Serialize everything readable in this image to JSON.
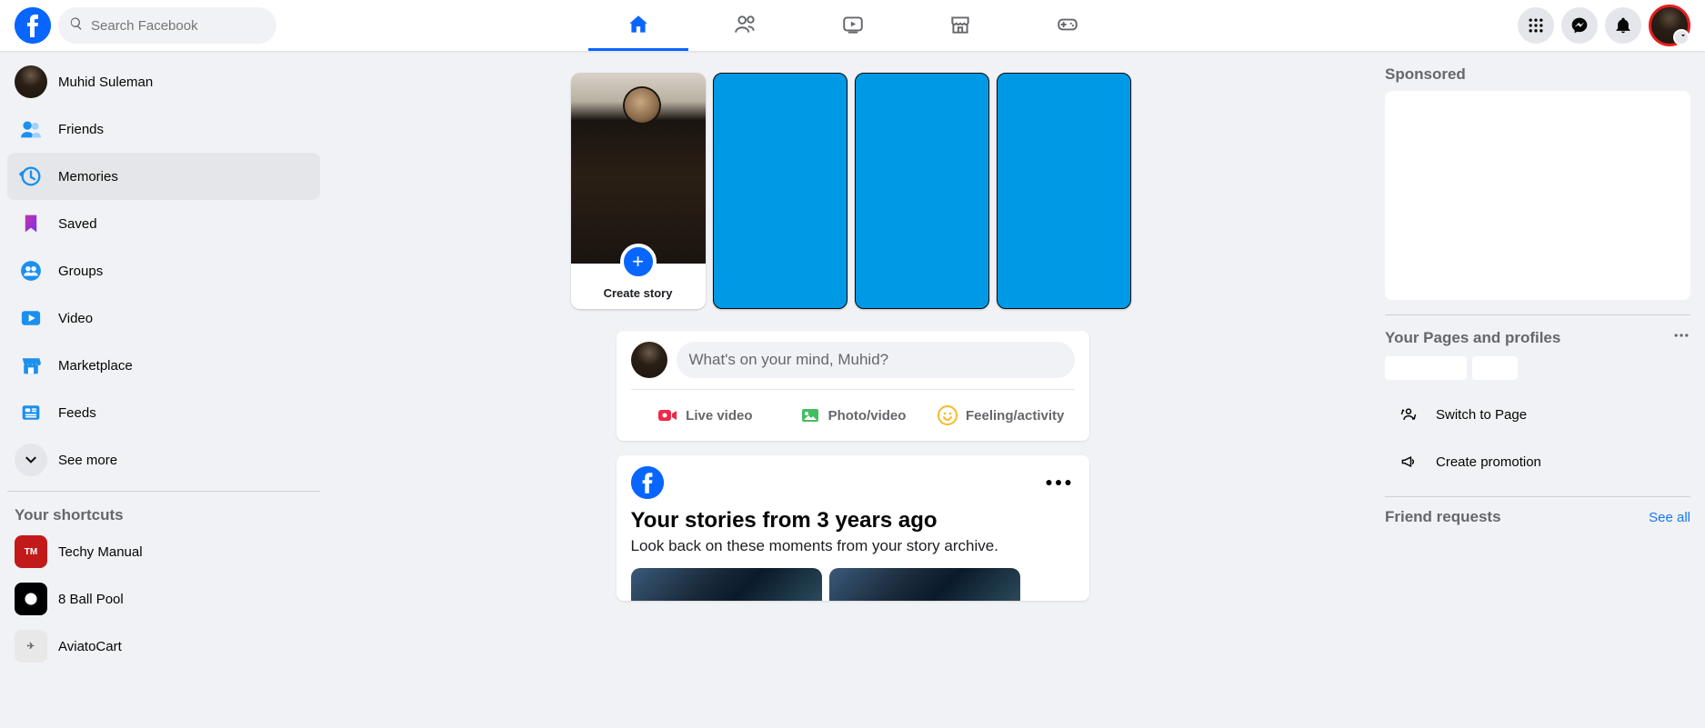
{
  "header": {
    "search_placeholder": "Search Facebook"
  },
  "sidebar": {
    "items": [
      {
        "label": "Muhid Suleman",
        "kind": "profile"
      },
      {
        "label": "Friends",
        "kind": "friends"
      },
      {
        "label": "Memories",
        "kind": "memories",
        "selected": true
      },
      {
        "label": "Saved",
        "kind": "saved"
      },
      {
        "label": "Groups",
        "kind": "groups"
      },
      {
        "label": "Video",
        "kind": "video"
      },
      {
        "label": "Marketplace",
        "kind": "marketplace"
      },
      {
        "label": "Feeds",
        "kind": "feeds"
      },
      {
        "label": "See more",
        "kind": "seemore"
      }
    ],
    "shortcuts_heading": "Your shortcuts",
    "shortcuts": [
      {
        "label": "Techy Manual",
        "bg": "#c21a1a"
      },
      {
        "label": "8 Ball Pool",
        "bg": "#1a1a1a"
      },
      {
        "label": "AviatoCart",
        "bg": "#e8e8e8"
      }
    ]
  },
  "stories": {
    "create_label": "Create story"
  },
  "composer": {
    "placeholder": "What's on your mind, Muhid?",
    "live_label": "Live video",
    "photo_label": "Photo/video",
    "feeling_label": "Feeling/activity"
  },
  "feed": {
    "memories_title": "Your stories from 3 years ago",
    "memories_sub": "Look back on these moments from your story archive."
  },
  "right": {
    "sponsored_heading": "Sponsored",
    "pages_heading": "Your Pages and profiles",
    "switch_label": "Switch to Page",
    "promote_label": "Create promotion",
    "requests_heading": "Friend requests",
    "see_all_label": "See all"
  }
}
